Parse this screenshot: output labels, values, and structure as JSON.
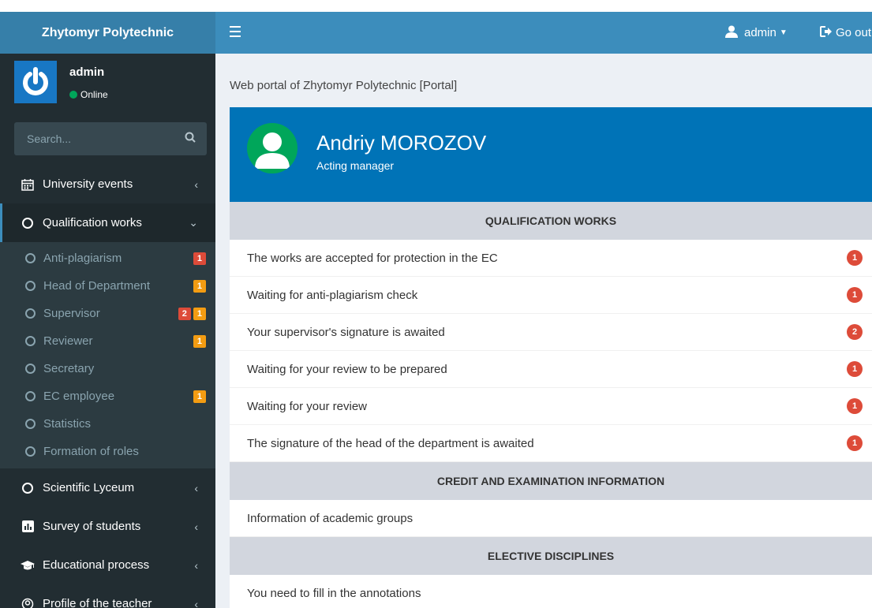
{
  "brand": "Zhytomyr Polytechnic",
  "user": {
    "name": "admin",
    "status": "Online"
  },
  "search": {
    "placeholder": "Search..."
  },
  "menu": {
    "university_events": "University events",
    "qualification_works": "Qualification works",
    "qualification_sub": [
      {
        "label": "Anti-plagiarism",
        "badges": [
          {
            "text": "1",
            "color": "#dd4b39"
          }
        ]
      },
      {
        "label": "Head of Department",
        "badges": [
          {
            "text": "1",
            "color": "#f39c12"
          }
        ]
      },
      {
        "label": "Supervisor",
        "badges": [
          {
            "text": "2",
            "color": "#dd4b39"
          },
          {
            "text": "1",
            "color": "#f39c12"
          }
        ]
      },
      {
        "label": "Reviewer",
        "badges": [
          {
            "text": "1",
            "color": "#f39c12"
          }
        ]
      },
      {
        "label": "Secretary",
        "badges": []
      },
      {
        "label": "EC employee",
        "badges": [
          {
            "text": "1",
            "color": "#f39c12"
          }
        ]
      },
      {
        "label": "Statistics",
        "badges": []
      },
      {
        "label": "Formation of roles",
        "badges": []
      }
    ],
    "scientific_lyceum": "Scientific Lyceum",
    "survey_of_students": "Survey of students",
    "educational_process": "Educational process",
    "profile_of_teacher": "Profile of the teacher"
  },
  "header": {
    "user_label": "admin",
    "logout_label": "Go out"
  },
  "breadcrumb": "Web portal of Zhytomyr Polytechnic [Portal]",
  "profile": {
    "name": "Andriy MOROZOV",
    "role": "Acting manager"
  },
  "sections": {
    "qualification_title": "QUALIFICATION WORKS",
    "qualification_rows": [
      {
        "label": "The works are accepted for protection in the EC",
        "count": "1"
      },
      {
        "label": "Waiting for anti-plagiarism check",
        "count": "1"
      },
      {
        "label": "Your supervisor's signature is awaited",
        "count": "2"
      },
      {
        "label": "Waiting for your review to be prepared",
        "count": "1"
      },
      {
        "label": "Waiting for your review",
        "count": "1"
      },
      {
        "label": "The signature of the head of the department is awaited",
        "count": "1"
      }
    ],
    "credit_title": "CREDIT AND EXAMINATION INFORMATION",
    "credit_rows": [
      {
        "label": "Information of academic groups"
      }
    ],
    "elective_title": "ELECTIVE DISCIPLINES",
    "elective_rows": [
      {
        "label": "You need to fill in the annotations"
      }
    ]
  },
  "colors": {
    "brand_bg": "#367fa9",
    "header_bg": "#3c8dbc",
    "sidebar_bg": "#222d32",
    "profile_bg": "#0073b7",
    "badge_red": "#dd4b39",
    "badge_orange": "#f39c12",
    "online_green": "#00a65a"
  }
}
